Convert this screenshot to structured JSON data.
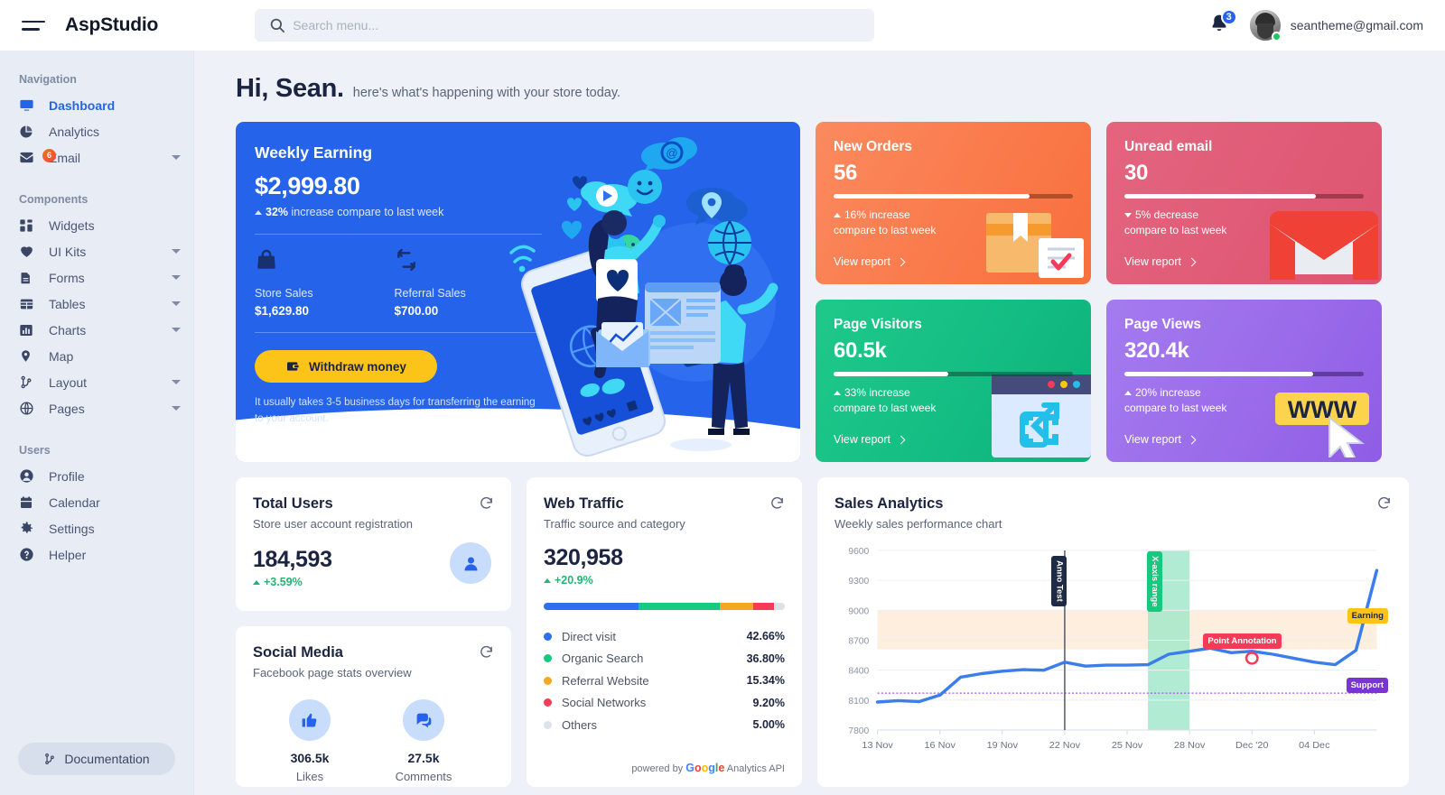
{
  "header": {
    "brand": "AspStudio",
    "menu_icon": "hamburger-icon",
    "search_placeholder": "Search menu...",
    "search_value": "",
    "notification_count": "3",
    "user_email": "seantheme@gmail.com"
  },
  "sidebar": {
    "sections": [
      {
        "label": "Navigation",
        "items": [
          {
            "label": "Dashboard",
            "icon": "monitor-icon",
            "active": true,
            "caret": false
          },
          {
            "label": "Analytics",
            "icon": "pie-chart-icon",
            "active": false,
            "caret": false
          },
          {
            "label": "Email",
            "icon": "envelope-icon",
            "active": false,
            "caret": true,
            "badge": "6"
          }
        ]
      },
      {
        "label": "Components",
        "items": [
          {
            "label": "Widgets",
            "icon": "widgets-icon",
            "active": false,
            "caret": false
          },
          {
            "label": "UI Kits",
            "icon": "heart-icon",
            "active": false,
            "caret": true
          },
          {
            "label": "Forms",
            "icon": "document-icon",
            "active": false,
            "caret": true
          },
          {
            "label": "Tables",
            "icon": "table-icon",
            "active": false,
            "caret": true
          },
          {
            "label": "Charts",
            "icon": "bar-chart-icon",
            "active": false,
            "caret": true
          },
          {
            "label": "Map",
            "icon": "map-pin-icon",
            "active": false,
            "caret": false
          },
          {
            "label": "Layout",
            "icon": "sitemap-icon",
            "active": false,
            "caret": true
          },
          {
            "label": "Pages",
            "icon": "globe-icon",
            "active": false,
            "caret": true
          }
        ]
      },
      {
        "label": "Users",
        "items": [
          {
            "label": "Profile",
            "icon": "user-circle-icon",
            "active": false,
            "caret": false
          },
          {
            "label": "Calendar",
            "icon": "calendar-icon",
            "active": false,
            "caret": false
          },
          {
            "label": "Settings",
            "icon": "gear-icon",
            "active": false,
            "caret": false
          },
          {
            "label": "Helper",
            "icon": "question-circle-icon",
            "active": false,
            "caret": false
          }
        ]
      }
    ],
    "documentation_label": "Documentation"
  },
  "greeting": {
    "title": "Hi, Sean.",
    "subtitle": "here's what's happening with your store today."
  },
  "weekly_earning": {
    "title": "Weekly Earning",
    "amount": "$2,999.80",
    "delta_value": "32%",
    "delta_text": "increase compare to last week",
    "store_sales_label": "Store Sales",
    "store_sales_value": "$1,629.80",
    "referral_sales_label": "Referral Sales",
    "referral_sales_value": "$700.00",
    "withdraw_label": "Withdraw money",
    "note": "It usually takes 3-5 business days for transferring the earning to your account.",
    "accent": "#2563eb",
    "button_color": "#fcc419"
  },
  "stat_cards": [
    {
      "title": "New Orders",
      "value": "56",
      "progress": 82,
      "delta_line1": "16% increase",
      "delta_line2": "compare to last week",
      "direction": "up",
      "link": "View report",
      "color": "#fa7a4b",
      "art": "package-icon"
    },
    {
      "title": "Unread email",
      "value": "30",
      "progress": 80,
      "delta_line1": "5% decrease",
      "delta_line2": "compare to last week",
      "direction": "down",
      "link": "View report",
      "color": "#e05b77",
      "art": "gmail-icon"
    },
    {
      "title": "Page Visitors",
      "value": "60.5k",
      "progress": 48,
      "delta_line1": "33% increase",
      "delta_line2": "compare to last week",
      "direction": "up",
      "link": "View report",
      "color": "#14bd83",
      "art": "browser-window-icon"
    },
    {
      "title": "Page Views",
      "value": "320.4k",
      "progress": 79,
      "delta_line1": "20% increase",
      "delta_line2": "compare to last week",
      "direction": "up",
      "link": "View report",
      "color": "#9a6bea",
      "art": "www-cursor-icon"
    }
  ],
  "total_users": {
    "title": "Total Users",
    "subtitle": "Store user account registration",
    "value": "184,593",
    "delta": "+3.59%",
    "icon": "user-icon"
  },
  "social_media": {
    "title": "Social Media",
    "subtitle": "Facebook page stats overview",
    "items": [
      {
        "value": "306.5k",
        "label": "Likes",
        "icon": "thumbs-up-icon"
      },
      {
        "value": "27.5k",
        "label": "Comments",
        "icon": "comment-icon"
      }
    ]
  },
  "web_traffic": {
    "title": "Web Traffic",
    "subtitle": "Traffic source and category",
    "value": "320,958",
    "delta": "+20.9%",
    "footer_prefix": "powered by",
    "footer_brand": "Google",
    "footer_suffix": "Analytics API",
    "sources": [
      {
        "name": "Direct visit",
        "percent": "42.66%",
        "value": 42.66,
        "color": "#2f6fed"
      },
      {
        "name": "Organic Search",
        "percent": "36.80%",
        "value": 36.8,
        "color": "#15c97e"
      },
      {
        "name": "Referral Website",
        "percent": "15.34%",
        "value": 15.34,
        "color": "#f5a623"
      },
      {
        "name": "Social Networks",
        "percent": "9.20%",
        "value": 9.2,
        "color": "#f53b57"
      },
      {
        "name": "Others",
        "percent": "5.00%",
        "value": 5.0,
        "color": "#dde1e8"
      }
    ]
  },
  "sales_analytics": {
    "title": "Sales Analytics",
    "subtitle": "Weekly sales performance chart"
  },
  "chart_data": {
    "type": "line",
    "title": "Sales Analytics",
    "subtitle": "Weekly sales performance chart",
    "xlabel": "",
    "ylabel": "",
    "ylim": [
      7800,
      9600
    ],
    "yticks": [
      7800,
      8100,
      8400,
      8700,
      9000,
      9300,
      9600
    ],
    "xticks": [
      "13 Nov",
      "16 Nov",
      "19 Nov",
      "22 Nov",
      "25 Nov",
      "28 Nov",
      "Dec '20",
      "04 Dec"
    ],
    "grid": true,
    "legend": false,
    "series": [
      {
        "name": "Earning",
        "color": "#3b7dea",
        "x": [
          "13 Nov",
          "14 Nov",
          "15 Nov",
          "16 Nov",
          "17 Nov",
          "18 Nov",
          "19 Nov",
          "20 Nov",
          "21 Nov",
          "22 Nov",
          "23 Nov",
          "24 Nov",
          "25 Nov",
          "26 Nov",
          "27 Nov",
          "28 Nov",
          "29 Nov",
          "30 Nov",
          "Dec '20",
          "02 Dec",
          "03 Dec",
          "04 Dec",
          "05 Dec",
          "06 Dec",
          "07 Dec"
        ],
        "values": [
          8080,
          8095,
          8085,
          8150,
          8330,
          8365,
          8390,
          8405,
          8400,
          8480,
          8440,
          8450,
          8450,
          8455,
          8560,
          8590,
          8620,
          8575,
          8590,
          8560,
          8520,
          8480,
          8455,
          8600,
          9400
        ]
      }
    ],
    "annotations": [
      {
        "kind": "x-axis-line",
        "label": "Anno Test",
        "x": "22 Nov",
        "bg": "#1f2a44",
        "text_color": "#ffffff"
      },
      {
        "kind": "x-axis-range",
        "label": "X-axis range",
        "x_start": "26 Nov",
        "x_end": "28 Nov",
        "bg": "#15c97e",
        "fill": "#9fe6c8"
      },
      {
        "kind": "point",
        "label": "Point Annotation",
        "x": "Dec '20",
        "y": 8520,
        "bg": "#f53b57",
        "marker_color": "#f53b57"
      },
      {
        "kind": "y-axis-line",
        "label": "Earning",
        "y": 8950,
        "bg": "#fcc419",
        "text_color": "#1b2440"
      },
      {
        "kind": "y-axis-line",
        "label": "Support",
        "y": 8170,
        "bg": "#7a34d1",
        "text_color": "#ffffff"
      },
      {
        "kind": "y-axis-range",
        "y_start": 8610,
        "y_end": 9000,
        "fill": "#fdeedd"
      }
    ]
  }
}
